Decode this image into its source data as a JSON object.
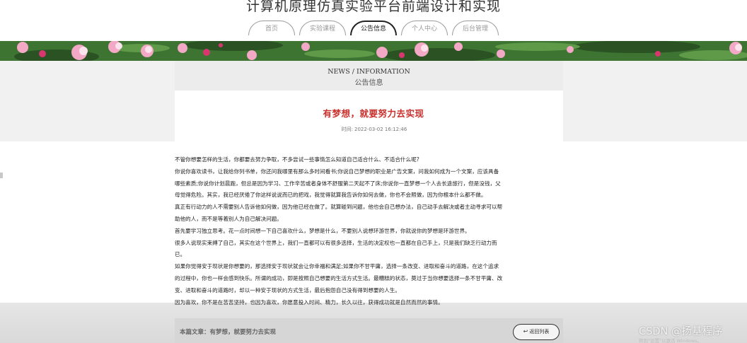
{
  "site": {
    "title": "计算机原理仿真实验平台前端设计和实现"
  },
  "nav": {
    "items": [
      {
        "label": "首页",
        "active": false
      },
      {
        "label": "实验课程",
        "active": false
      },
      {
        "label": "公告信息",
        "active": true
      },
      {
        "label": "个人中心",
        "active": false
      },
      {
        "label": "后台管理",
        "active": false
      }
    ]
  },
  "section": {
    "heading": "NEWS / INFORMATION",
    "subheading": "公告信息"
  },
  "article": {
    "title": "有梦想，就要努力去实现",
    "time_label": "时间:",
    "time_value": "2022-03-02 16:12:46",
    "paragraphs": [
      "不管你想要怎样的生活，你都要去努力争取，不多尝试一些事情怎么知道自己适合什么、不适合什么呢?",
      "你说你喜欢读书，让我给你列书单，你还问我哪里有那么多时间看书;你说自己梦想的职业是广告文案，问我如何成为一个文案，应该具备",
      "哪些素质;你说你计划晨跑，但总是因为学习、工作辛苦或者身体不舒服第二天起不了床;你说你一直梦想一个人去长途旅行，但是没钱，父",
      "母觉得危险。其实，我已经厌倦了你这样说说而已的把戏，我觉得就算我告诉你如何去做，你也不会照做，因为你根本什么都不做。",
      "真正有行动力的人不需要别人告诉他如何做，因为他已经在做了。就算碰到问题，他也会自己想办法，自己动手去解决或者主动寻求可以帮",
      "助他的人，而不是等着别人为自己解决问题。",
      "首先要学习独立思考。花一点时间想一下自己喜欢什么，梦想是什么，不要别人说想环游世界，你就说你的梦想是环游世界。",
      "很多人说现实束缚了自己，其实在这个世界上，我们一直都可以有很多选择，生活的决定权也一直都在自己手上，只是我们缺乏行动力而",
      "已。",
      "如果你觉得安于现状是你想要的，那选择安于现状就会让你幸福和满足;如果你不甘平庸，选择一条改变、进取和奋斗的道路，在这个追求",
      "的过程中，你也一样会感到快乐。所谓的成功，即是按照自己想要的生活方式生活。最糟糕的状态，莫过于当你想要选择一条不甘平庸、改",
      "变、进取和奋斗的道路时，却以一种安于现状的方式生活，最后抱怨自己没有得到想要的人生。",
      "因为喜欢，你不是在苦苦坚持，也因为喜欢，你愿意投入时间、精力，长久以往，获得成功就是自然而然的事情。"
    ]
  },
  "footer": {
    "current_article": "本篇文章：有梦想，就要努力去实现",
    "back_label": "返回列表",
    "back_icon": "return-arrow-icon"
  },
  "overlay": {
    "watermark": "CSDN @扬基程序",
    "windows_note": "转到\"设置\"以激活 Windows。"
  }
}
